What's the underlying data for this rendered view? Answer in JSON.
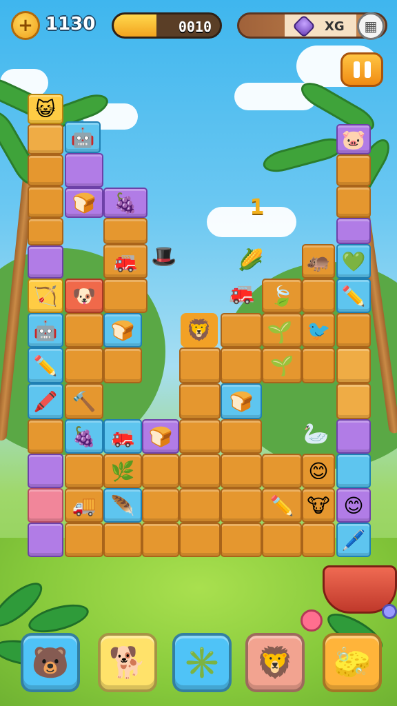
{
  "hud": {
    "coins": "1130",
    "progress_text": "0010",
    "progress_fraction": 0.4,
    "gem_text": "XG"
  },
  "board": {
    "floating_number": "1"
  },
  "colors": {
    "sky": "#3fb6ee",
    "grass": "#86c93b",
    "tile_orange": "#e5972f",
    "tile_purple": "#b17ce6",
    "tile_blue": "#5ec5ef",
    "tile_pink": "#f1869a",
    "accent_yellow": "#ffc543"
  },
  "icons": {
    "coin": "plus-coin-icon",
    "gem": "purple-gem-icon",
    "menu": "grid-icon",
    "pause": "pause-icon"
  },
  "bottom_bar": [
    {
      "name": "bear-face-button",
      "color": "#4fc3f7"
    },
    {
      "name": "cube-pet-button",
      "color": "#ffe26a"
    },
    {
      "name": "spiky-star-button",
      "color": "#4fc3f7"
    },
    {
      "name": "lion-face-button",
      "color": "#f2a390"
    },
    {
      "name": "block-eraser-button",
      "color": "#ffb43a"
    }
  ]
}
